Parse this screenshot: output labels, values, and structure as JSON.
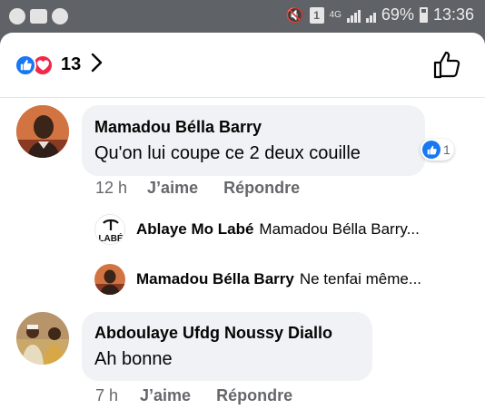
{
  "status_bar": {
    "network": "4G",
    "battery": "69%",
    "time": "13:36"
  },
  "header": {
    "reaction_count": "13"
  },
  "comments": [
    {
      "author": "Mamadou Béllа Barry",
      "text": "Qu'on lui coupe ce 2 deux couille",
      "reaction_count": "1",
      "time": "12 h",
      "like_label": "J’aime",
      "reply_label": "Répondre",
      "replies": [
        {
          "author": "Ablaye Mo Labé",
          "preview": "Mamadou Béllа Barry...",
          "avatar_text": "LABÉ"
        },
        {
          "author": "Mamadou Béllа Barry",
          "preview": "Ne tenfai même..."
        }
      ]
    },
    {
      "author": "Abdoulaye Ufdg Noussy Diallo",
      "text": "Ah bonne",
      "time": "7 h",
      "like_label": "J’aime",
      "reply_label": "Répondre"
    }
  ],
  "colors": {
    "like_blue": "#1877f2",
    "love_red": "#f0284a",
    "bubble": "#f0f2f5",
    "secondary_text": "#65676b",
    "status_bar": "#5f6266"
  },
  "icons": [
    "status-app-icon",
    "folder-icon",
    "mute-icon",
    "sim-icon",
    "signal-icon",
    "battery-icon",
    "like-icon",
    "love-icon",
    "chevron-right-icon",
    "thumbs-up-outline-icon"
  ]
}
